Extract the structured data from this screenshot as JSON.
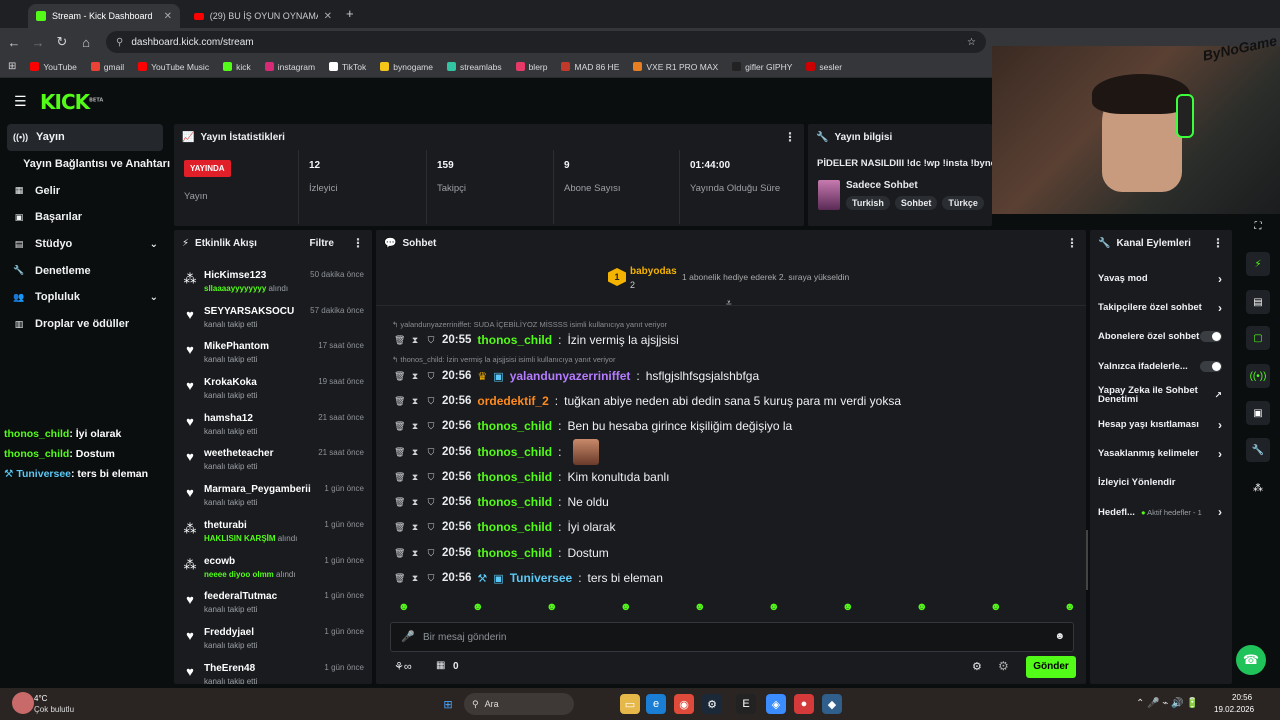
{
  "browser": {
    "tabs": [
      {
        "label": "Stream - Kick Dashboard",
        "active": true
      },
      {
        "label": "(29) BU İŞ OYUN OYNAMAYA B...",
        "active": false
      }
    ],
    "url": "dashboard.kick.com/stream",
    "bookmarks": [
      {
        "label": "YouTube",
        "color": "#ff0000"
      },
      {
        "label": "gmail",
        "color": "#ea4335"
      },
      {
        "label": "YouTube Music",
        "color": "#ff0000"
      },
      {
        "label": "kick",
        "color": "#53fc18"
      },
      {
        "label": "instagram",
        "color": "#d62976"
      },
      {
        "label": "TikTok",
        "color": "#ffffff"
      },
      {
        "label": "bynogame",
        "color": "#f5c518"
      },
      {
        "label": "streamlabs",
        "color": "#31c3a2"
      },
      {
        "label": "blerp",
        "color": "#e63967"
      },
      {
        "label": "MAD 86 HE",
        "color": "#c0392b"
      },
      {
        "label": "VXE R1 PRO MAX",
        "color": "#e67e22"
      },
      {
        "label": "gifler GIPHY",
        "color": "#222222"
      },
      {
        "label": "sesler",
        "color": "#cc0000"
      }
    ]
  },
  "kick": {
    "logo": "KICK",
    "logo_sup": "BETA",
    "nav": [
      {
        "label": "Yayın",
        "icon": "broadcast-icon",
        "glyph": "((•))",
        "active": true
      },
      {
        "label": "Yayın Bağlantısı ve Anahtarı",
        "icon": "",
        "glyph": "",
        "active": false
      },
      {
        "label": "Gelir",
        "icon": "revenue-icon",
        "glyph": "▦",
        "active": false
      },
      {
        "label": "Başarılar",
        "icon": "achievements-icon",
        "glyph": "▣",
        "active": false
      },
      {
        "label": "Stüdyo",
        "icon": "studio-icon",
        "glyph": "▤",
        "active": false,
        "chevron": true
      },
      {
        "label": "Denetleme",
        "icon": "wrench-icon",
        "glyph": "🔧",
        "active": false
      },
      {
        "label": "Topluluk",
        "icon": "community-icon",
        "glyph": "👥",
        "active": false,
        "chevron": true
      },
      {
        "label": "Droplar ve ödüller",
        "icon": "drops-icon",
        "glyph": "▥",
        "active": false
      }
    ],
    "stats": {
      "title": "Yayın İstatistikleri",
      "live_badge": "YAYINDA",
      "live_label": "Yayın",
      "cells": [
        {
          "value": "12",
          "label": "İzleyici"
        },
        {
          "value": "159",
          "label": "Takipçi"
        },
        {
          "value": "9",
          "label": "Abone Sayısı"
        },
        {
          "value": "01:44:00",
          "label": "Yayında Olduğu Süre"
        }
      ]
    },
    "info": {
      "title": "Yayın bilgisi",
      "stream_title": "PİDELER NASILDIII !dc !wp !insta !bynog",
      "category": "Sadece Sohbet",
      "tags": [
        "Turkish",
        "Sohbet",
        "Türkçe"
      ]
    },
    "activity": {
      "title": "Etkinlik Akışı",
      "filter": "Filtre",
      "items": [
        {
          "name": "HicKimse123",
          "sub_green": "sllaaaayyyyyyyy",
          "sub": "alındı",
          "time": "50 dakika önce",
          "type": "reward"
        },
        {
          "name": "SEYYARSAKSOCU",
          "sub_green": "",
          "sub": "kanalı takip etti",
          "time": "57 dakika önce",
          "type": "follow"
        },
        {
          "name": "MikePhantom",
          "sub_green": "",
          "sub": "kanalı takip etti",
          "time": "17 saat önce",
          "type": "follow"
        },
        {
          "name": "KrokaKoka",
          "sub_green": "",
          "sub": "kanalı takip etti",
          "time": "19 saat önce",
          "type": "follow"
        },
        {
          "name": "hamsha12",
          "sub_green": "",
          "sub": "kanalı takip etti",
          "time": "21 saat önce",
          "type": "follow"
        },
        {
          "name": "weetheteacher",
          "sub_green": "",
          "sub": "kanalı takip etti",
          "time": "21 saat önce",
          "type": "follow"
        },
        {
          "name": "Marmara_Peygamberii",
          "sub_green": "",
          "sub": "kanalı takip etti",
          "time": "1 gün önce",
          "type": "follow"
        },
        {
          "name": "theturabi",
          "sub_green": "HAKLISIN KARŞİM",
          "sub": "alındı",
          "time": "1 gün önce",
          "type": "reward"
        },
        {
          "name": "ecowb",
          "sub_green": "neeee diyoo olmm",
          "sub": "alındı",
          "time": "1 gün önce",
          "type": "reward"
        },
        {
          "name": "feederalTutmac",
          "sub_green": "",
          "sub": "kanalı takip etti",
          "time": "1 gün önce",
          "type": "follow"
        },
        {
          "name": "Freddyjael",
          "sub_green": "",
          "sub": "kanalı takip etti",
          "time": "1 gün önce",
          "type": "follow"
        },
        {
          "name": "TheEren48",
          "sub_green": "",
          "sub": "kanalı takip etti",
          "time": "1 gün önce",
          "type": "follow"
        }
      ]
    },
    "chat": {
      "title": "Sohbet",
      "pinned_user": "babyodas",
      "pinned_count": "2",
      "pinned_rank": "1",
      "pinned_text": "1 abonelik hediye ederek 2. sıraya yükseldin",
      "replies": [
        "yalandunyazerriniffet: SUDA İÇEBİLİYOZ MİSSSS isimli kullanıcıya yanıt veriyor",
        "thonos_child: İzin vermiş la ajsjjsisi isimli kullanıcıya yanıt veriyor"
      ],
      "messages": [
        {
          "time": "20:55",
          "user": "thonos_child",
          "color": "#53fc18",
          "text": "İzin vermiş la ajsjjsisi"
        },
        {
          "time": "20:56",
          "user": "yalandunyazerriniffet",
          "color": "#b57cff",
          "text": "hsflgjslhfsgsjalshbfga"
        },
        {
          "time": "20:56",
          "user": "ordedektif_2",
          "color": "#ff8a1f",
          "text": "tuğkan abiye neden abi dedin sana 5 kuruş para mı verdi yoksa"
        },
        {
          "time": "20:56",
          "user": "thonos_child",
          "color": "#53fc18",
          "text": "Ben bu hesaba girince kişiliğim değişiyo la"
        },
        {
          "time": "20:56",
          "user": "thonos_child",
          "color": "#53fc18",
          "text": ""
        },
        {
          "time": "20:56",
          "user": "thonos_child",
          "color": "#53fc18",
          "text": "Kim konultıda banlı"
        },
        {
          "time": "20:56",
          "user": "thonos_child",
          "color": "#53fc18",
          "text": "Ne oldu"
        },
        {
          "time": "20:56",
          "user": "thonos_child",
          "color": "#53fc18",
          "text": "İyi olarak"
        },
        {
          "time": "20:56",
          "user": "thonos_child",
          "color": "#53fc18",
          "text": "Dostum"
        },
        {
          "time": "20:56",
          "user": "Tuniversee",
          "color": "#5bc8f5",
          "text": "ters bi eleman"
        }
      ],
      "input_placeholder": "Bir mesaj gönderin",
      "points": "0",
      "send": "Gönder"
    },
    "channel_actions": {
      "title": "Kanal Eylemleri",
      "items": [
        {
          "label": "Yavaş mod",
          "kind": "arrow"
        },
        {
          "label": "Takipçilere özel sohbet",
          "kind": "arrow"
        },
        {
          "label": "Abonelere özel sohbet",
          "kind": "toggle"
        },
        {
          "label": "Yalnızca ifadelerle...",
          "kind": "toggle"
        },
        {
          "label": "Yapay Zeka ile Sohbet Denetimi",
          "kind": "external"
        },
        {
          "label": "Hesap yaşı kısıtlaması",
          "kind": "arrow"
        },
        {
          "label": "Yasaklanmış kelimeler",
          "kind": "arrow"
        },
        {
          "label": "İzleyici Yönlendir",
          "kind": "none"
        },
        {
          "label": "Hedefl...",
          "kind": "goal",
          "extra": "Aktif hedefler - 1"
        }
      ]
    }
  },
  "overlay_chat": [
    {
      "user": "thonos_child",
      "text": ": İyi olarak"
    },
    {
      "user": "thonos_child",
      "text": ": Dostum"
    },
    {
      "user": "Tuniversee",
      "text": ": ters bi eleman"
    }
  ],
  "webcam_watermark": "ByNoGame",
  "taskbar": {
    "weather_temp": "4°C",
    "weather_desc": "Çok bulutlu",
    "search": "Ara",
    "time": "20:56",
    "date": "19.02.2026"
  }
}
